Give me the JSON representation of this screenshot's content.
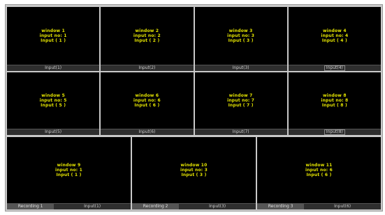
{
  "rows": [
    [
      {
        "window": "window 1",
        "input_no": "input no: 1",
        "input": "Input ( 1 )",
        "bar": "Input(1)"
      },
      {
        "window": "window 2",
        "input_no": "input no: 2",
        "input": "Input ( 2 )",
        "bar": "Input(2)"
      },
      {
        "window": "window 3",
        "input_no": "input no: 3",
        "input": "Input ( 3 )",
        "bar": "Input(3)"
      },
      {
        "window": "window 4",
        "input_no": "input no: 4",
        "input": "Input ( 4 )",
        "bar": "Input(4)"
      }
    ],
    [
      {
        "window": "window 5",
        "input_no": "input no: 5",
        "input": "Input ( 5 )",
        "bar": "Input(5)"
      },
      {
        "window": "window 6",
        "input_no": "input no: 6",
        "input": "Input ( 6 )",
        "bar": "Input(6)"
      },
      {
        "window": "window 7",
        "input_no": "input no: 7",
        "input": "Input ( 7 )",
        "bar": "Input(7)"
      },
      {
        "window": "window 8",
        "input_no": "input no: 8",
        "input": "Input ( 8 )",
        "bar": "Input(8)"
      }
    ],
    [
      {
        "window": "window 9",
        "input_no": "input no: 1",
        "input": "Input ( 1 )",
        "rec": "Recording 1",
        "bar": "Input(1)"
      },
      {
        "window": "window 10",
        "input_no": "input no: 3",
        "input": "Input ( 3 )",
        "rec": "Recording 2",
        "bar": "Input(3)"
      },
      {
        "window": "window 11",
        "input_no": "input no: 6",
        "input": "Input ( 6 )",
        "rec": "Recording 3",
        "bar": "Input(6)"
      }
    ]
  ]
}
